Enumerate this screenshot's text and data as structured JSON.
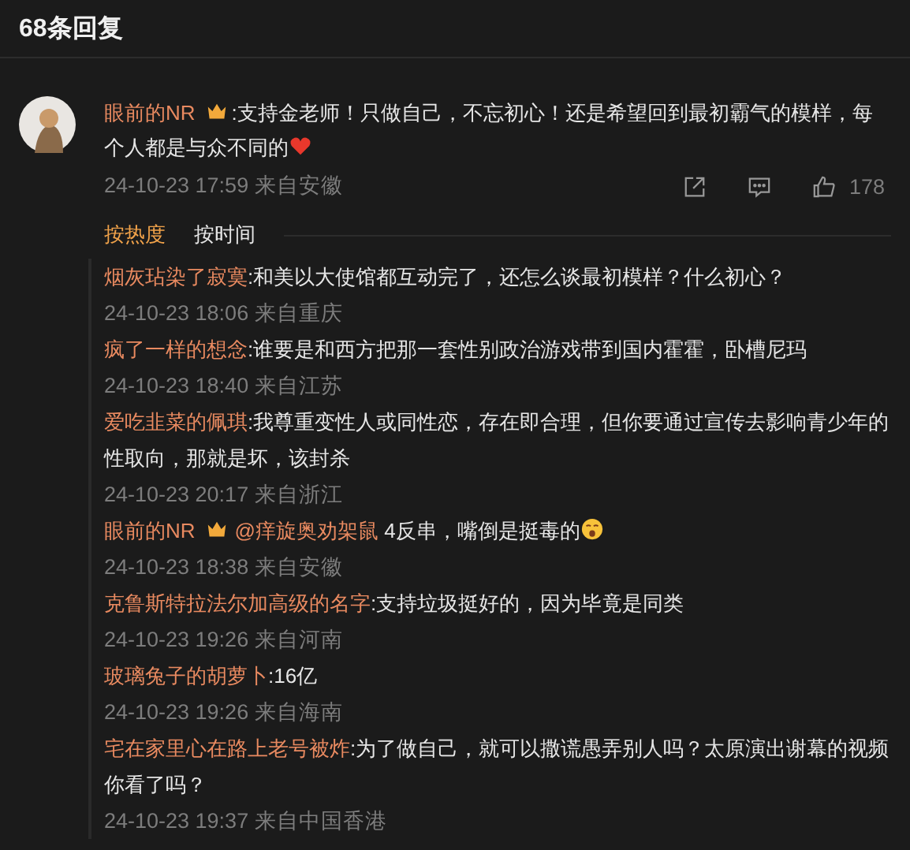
{
  "header": {
    "title": "68条回复"
  },
  "comment": {
    "user": "眼前的NR",
    "crown": true,
    "text": ":支持金老师！只做自己，不忘初心！还是希望回到最初霸气的模样，每个人都是与众不同的",
    "heart_emoji": true,
    "time": "24-10-23 17:59 来自安徽",
    "likes": "178"
  },
  "sort_tabs": [
    {
      "label": "按热度",
      "selected": true
    },
    {
      "label": "按时间",
      "selected": false
    }
  ],
  "replies": [
    {
      "user": "烟灰玷染了寂寞",
      "crown": false,
      "text": ":和美以大使馆都互动完了，还怎么谈最初模样？什么初心？",
      "time": "24-10-23 18:06 来自重庆"
    },
    {
      "user": "疯了一样的想念",
      "crown": false,
      "text": ":谁要是和西方把那一套性别政治游戏带到国内霍霍，卧槽尼玛",
      "time": "24-10-23 18:40 来自江苏"
    },
    {
      "user": "爱吃韭菜的佩琪",
      "crown": false,
      "text": ":我尊重变性人或同性恋，存在即合理，但你要通过宣传去影响青少年的性取向，那就是坏，该封杀",
      "time": "24-10-23 20:17 来自浙江"
    },
    {
      "user": "眼前的NR",
      "crown": true,
      "mention": "@痒旋奥劝架鼠",
      "text": " 4反串，嘴倒是挺毒的",
      "face_emoji": true,
      "time": "24-10-23 18:38 来自安徽"
    },
    {
      "user": "克鲁斯特拉法尔加高级的名字",
      "crown": false,
      "text": ":支持垃圾挺好的，因为毕竟是同类",
      "time": "24-10-23 19:26 来自河南"
    },
    {
      "user": "玻璃兔子的胡萝卜",
      "crown": false,
      "text": ":16亿",
      "time": "24-10-23 19:26 来自海南"
    },
    {
      "user": "宅在家里心在路上老号被炸",
      "crown": false,
      "text": ":为了做自己，就可以撒谎愚弄别人吗？太原演出谢幕的视频你看了吗？",
      "time": "24-10-23 19:37 来自中国香港"
    }
  ]
}
